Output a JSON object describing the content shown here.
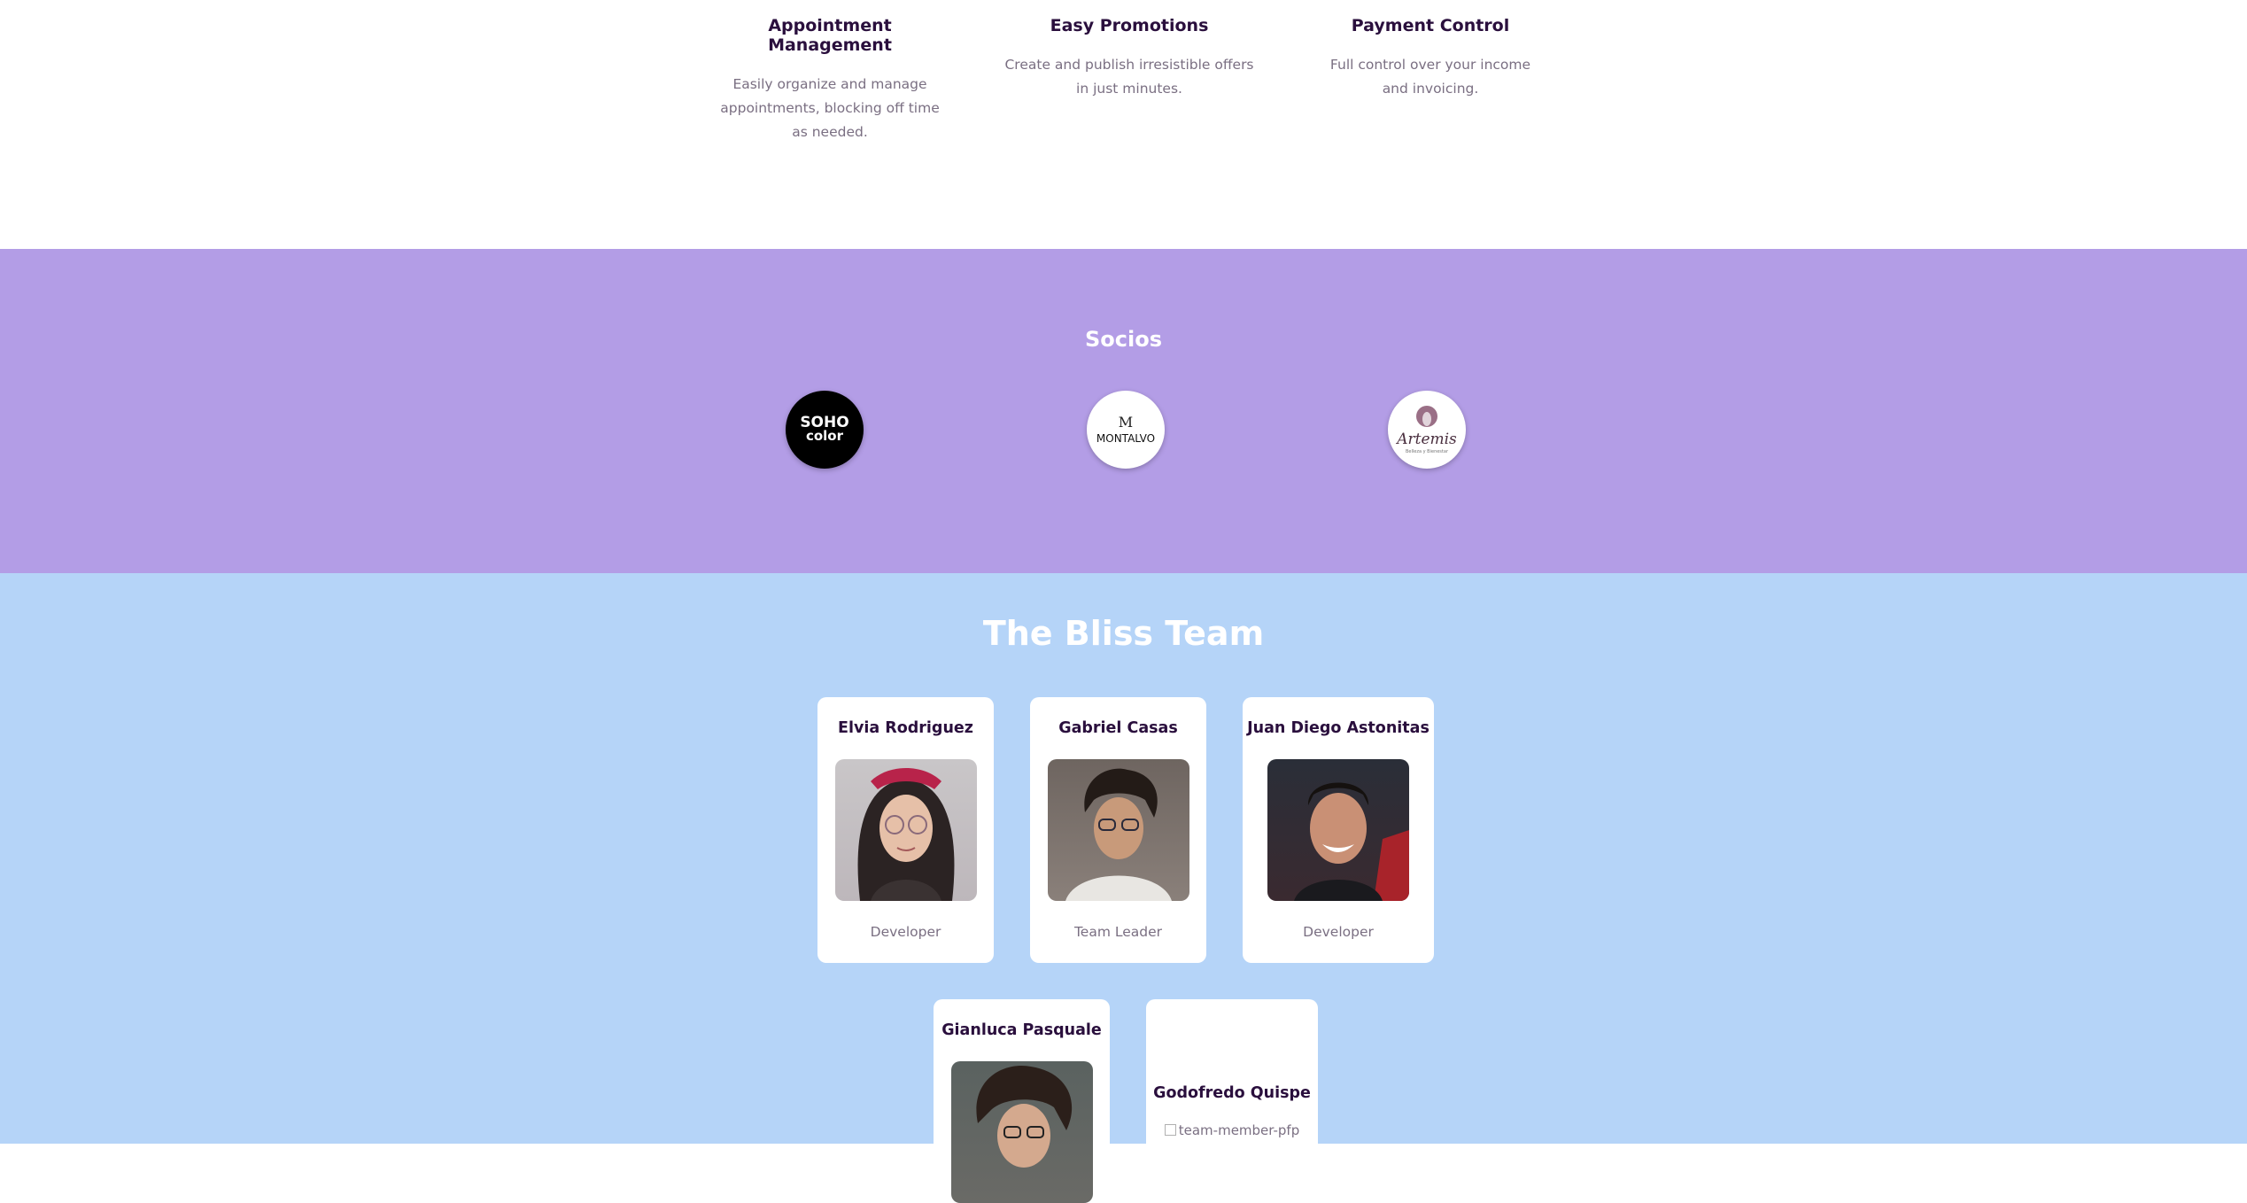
{
  "features": [
    {
      "title": "Appointment Management",
      "desc": "Easily organize and manage appointments, blocking off time as needed."
    },
    {
      "title": "Easy Promotions",
      "desc": "Create and publish irresistible offers in just minutes."
    },
    {
      "title": "Payment Control",
      "desc": "Full control over your income and invoicing."
    }
  ],
  "partners": {
    "title": "Socios",
    "logos": [
      {
        "name": "SOHO color",
        "line1": "SOHO",
        "line2": "color"
      },
      {
        "name": "MONTALVO",
        "mark": "M",
        "text": "MONTALVO"
      },
      {
        "name": "Artemis",
        "text": "Artemis",
        "sub": "Belleza y Bienestar"
      }
    ]
  },
  "team": {
    "title": "The Bliss Team",
    "members": [
      {
        "name": "Elvia Rodriguez",
        "role": "Developer"
      },
      {
        "name": "Gabriel Casas",
        "role": "Team Leader"
      },
      {
        "name": "Juan Diego Astonitas",
        "role": "Developer"
      },
      {
        "name": "Gianluca Pasquale",
        "role": ""
      },
      {
        "name": "Godofredo Quispe",
        "role": "",
        "img_alt": "team-member-pfp"
      }
    ]
  },
  "colors": {
    "partners_bg": "#b39de6",
    "team_bg": "#b5d4f8",
    "heading": "#2a0f3d",
    "muted": "#7a6f82"
  }
}
